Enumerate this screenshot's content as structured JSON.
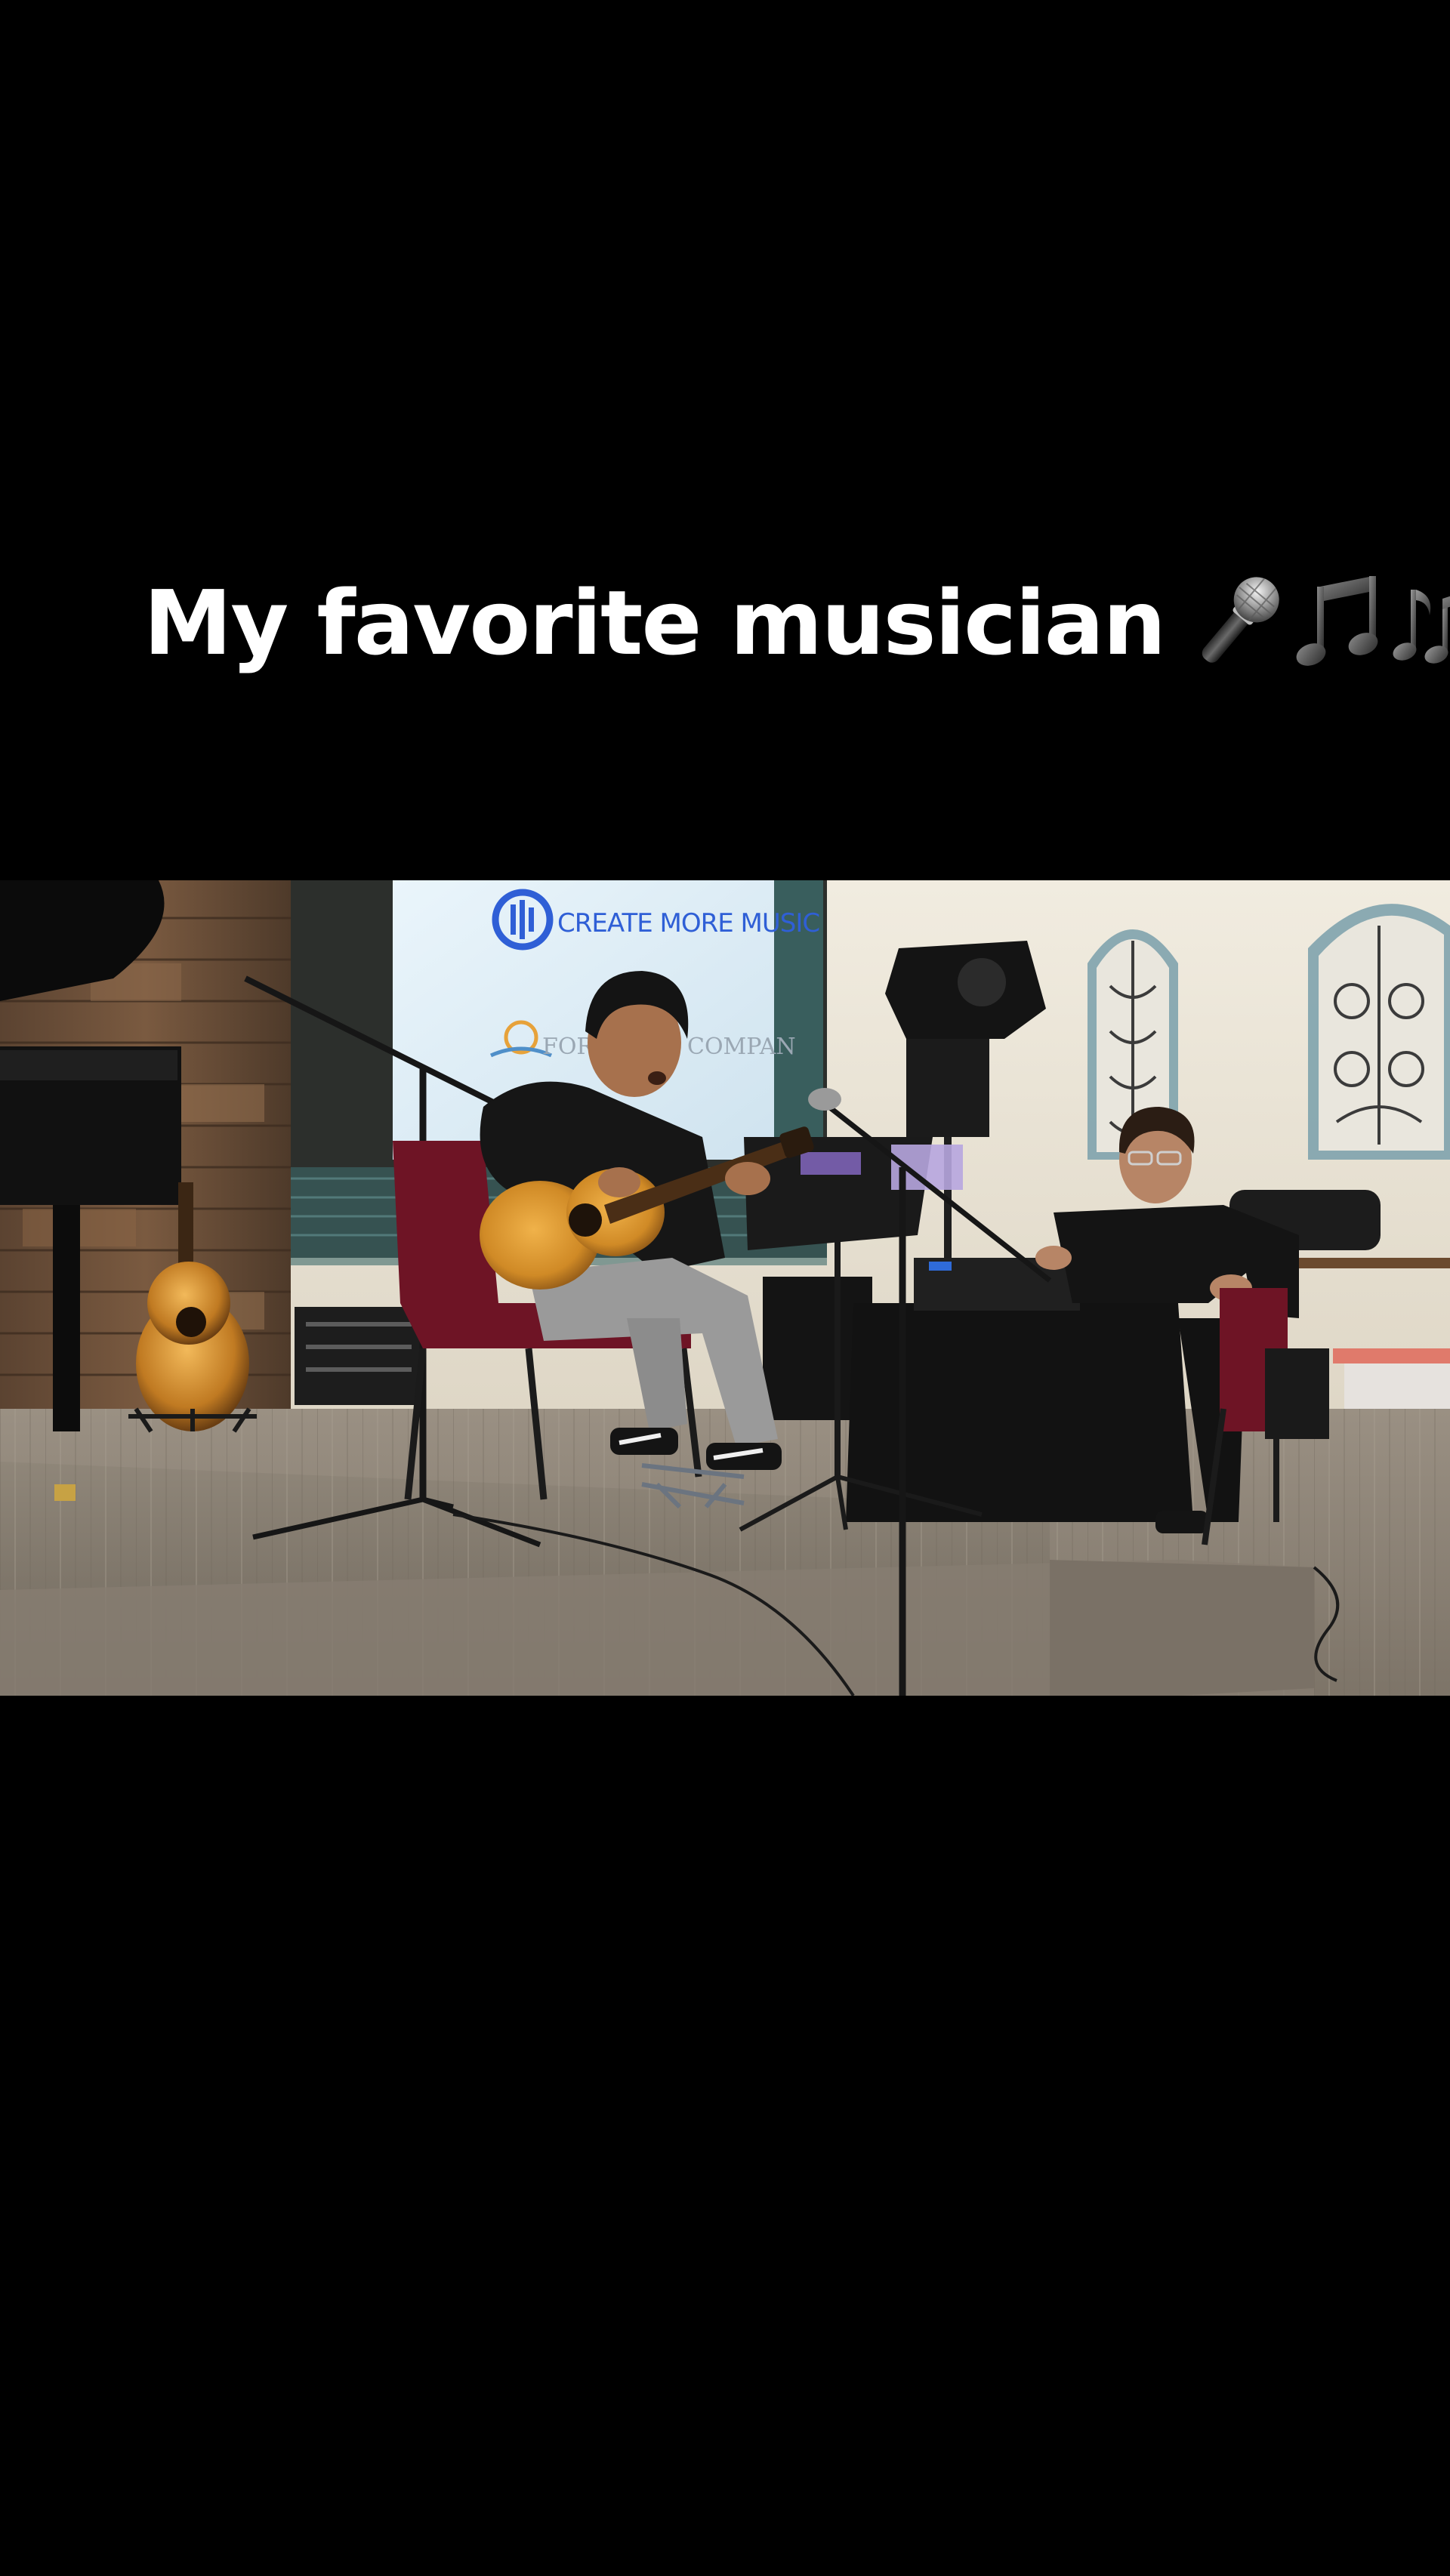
{
  "caption": {
    "text": "My favorite musician",
    "emoji_icons": [
      "microphone-icon",
      "musical-note-icon",
      "musical-notes-icon"
    ]
  },
  "photo": {
    "screen_text": {
      "brand_line": "CREATE MORE MUSIC",
      "secondary_line": "FORI",
      "secondary_line_end": "COMPAN"
    }
  },
  "colors": {
    "background": "#000000",
    "caption_text": "#ffffff",
    "brand_blue": "#2f5fd6",
    "screen_bg": "#dfeef8",
    "chair_red": "#6e1425",
    "guitar_wood": "#d9942e",
    "carpet": "#8c8276",
    "wall": "#ece6d8"
  }
}
